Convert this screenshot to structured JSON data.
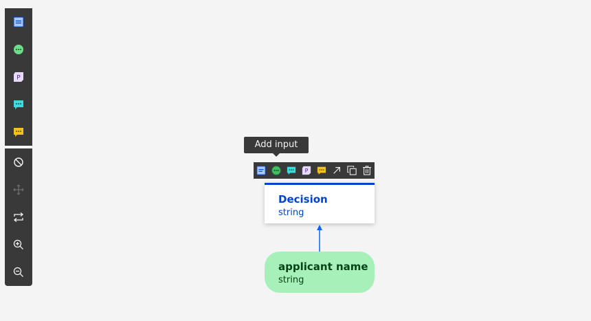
{
  "palette": {
    "node_tools": [
      {
        "name": "decision-tool-icon",
        "color": "#a6c8ff"
      },
      {
        "name": "input-data-tool-icon",
        "color": "#6fdc8c"
      },
      {
        "name": "bkm-tool-icon",
        "color": "#e8daff"
      },
      {
        "name": "knowledge-source-tool-icon",
        "color": "#3ddbd9"
      },
      {
        "name": "text-annotation-tool-icon",
        "color": "#f1c21b"
      }
    ],
    "view_tools": [
      {
        "name": "hide-icon"
      },
      {
        "name": "move-icon"
      },
      {
        "name": "swap-icon"
      },
      {
        "name": "zoom-in-icon"
      },
      {
        "name": "zoom-out-icon"
      }
    ]
  },
  "tooltip": {
    "text": "Add input"
  },
  "context_toolbar": {
    "items": [
      {
        "name": "add-decision-icon"
      },
      {
        "name": "add-input-icon"
      },
      {
        "name": "add-knowledge-source-icon"
      },
      {
        "name": "add-bkm-icon"
      },
      {
        "name": "add-annotation-icon"
      },
      {
        "name": "connect-arrow-icon"
      },
      {
        "name": "duplicate-icon"
      },
      {
        "name": "delete-icon"
      }
    ]
  },
  "nodes": {
    "decision": {
      "title": "Decision",
      "type": "string",
      "accent_color": "#0043ce"
    },
    "input": {
      "title": "applicant name",
      "type": "string",
      "fill_color": "#a7f0ba"
    }
  },
  "bkm_letter": "P"
}
